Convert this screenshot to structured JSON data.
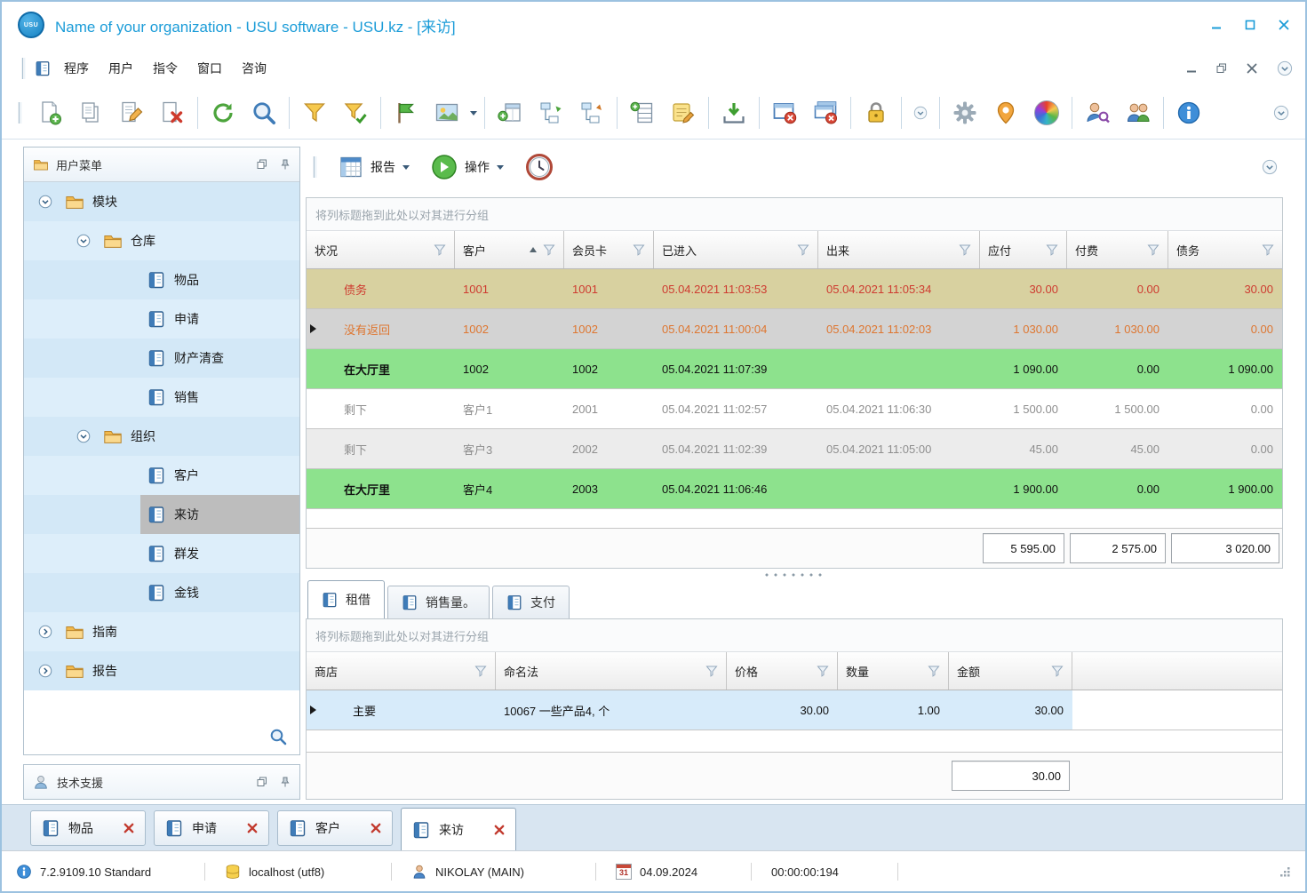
{
  "colors": {
    "accent_blue": "#1B9CD8",
    "row_debt_bg": "#D8D1A0",
    "row_debt_text": "#CE3B30",
    "row_no_return_bg": "#D3D3D3",
    "row_no_return_text": "#DE7630",
    "row_in_hall_bg": "#8DE28D",
    "row_left_text": "#8E8E8E",
    "selected_nav_bg": "#BDBDBD",
    "detail_row_bg": "#D7EBFA"
  },
  "window": {
    "title": "Name of your organization - USU software - USU.kz - [来访]",
    "logo": "USU"
  },
  "menubar": {
    "items": [
      {
        "label": "程序"
      },
      {
        "label": "用户"
      },
      {
        "label": "指令"
      },
      {
        "label": "窗口"
      },
      {
        "label": "咨询"
      }
    ]
  },
  "toolbar": {
    "icons": [
      "new-document",
      "copy",
      "edit",
      "delete",
      "refresh",
      "search",
      "filter",
      "filter-apply",
      "flag",
      "image",
      "add-column",
      "expand-tree",
      "collapse-tree",
      "add-row",
      "notes",
      "export",
      "close-window",
      "close-all-windows",
      "lock",
      "toolbar-overflow",
      "settings",
      "location",
      "colors",
      "user-search",
      "users",
      "info"
    ]
  },
  "sidebar": {
    "title": "用户菜单",
    "tree": [
      {
        "label": "模块",
        "type": "folder",
        "level": 0,
        "expanded": true
      },
      {
        "label": "仓库",
        "type": "folder",
        "level": 1,
        "expanded": true
      },
      {
        "label": "物品",
        "type": "item",
        "level": 2
      },
      {
        "label": "申请",
        "type": "item",
        "level": 2
      },
      {
        "label": "财产清查",
        "type": "item",
        "level": 2
      },
      {
        "label": "销售",
        "type": "item",
        "level": 2
      },
      {
        "label": "组织",
        "type": "folder",
        "level": 1,
        "expanded": true
      },
      {
        "label": "客户",
        "type": "item",
        "level": 2
      },
      {
        "label": "来访",
        "type": "item",
        "level": 2,
        "selected": true
      },
      {
        "label": "群发",
        "type": "item",
        "level": 2
      },
      {
        "label": "金钱",
        "type": "item",
        "level": 2
      },
      {
        "label": "指南",
        "type": "folder",
        "level": 0,
        "expanded": false
      },
      {
        "label": "报告",
        "type": "folder",
        "level": 0,
        "expanded": false
      }
    ],
    "support_panel": "技术支援"
  },
  "report_toolbar": {
    "report_button": "报告",
    "action_button": "操作"
  },
  "visits": {
    "group_hint": "将列标题拖到此处以对其进行分组",
    "columns": [
      "状况",
      "客户",
      "会员卡",
      "已进入",
      "出来",
      "应付",
      "付费",
      "债务"
    ],
    "rows": [
      {
        "status": "债务",
        "client": "1001",
        "card": "1001",
        "entered": "05.04.2021 11:03:53",
        "exited": "05.04.2021 11:05:34",
        "payable": "30.00",
        "paid": "0.00",
        "debt": "30.00",
        "state": "debt"
      },
      {
        "status": "没有返回",
        "client": "1002",
        "card": "1002",
        "entered": "05.04.2021 11:00:04",
        "exited": "05.04.2021 11:02:03",
        "payable": "1 030.00",
        "paid": "1 030.00",
        "debt": "0.00",
        "state": "no-return",
        "selected": true
      },
      {
        "status": "在大厅里",
        "client": "1002",
        "card": "1002",
        "entered": "05.04.2021 11:07:39",
        "exited": "",
        "payable": "1 090.00",
        "paid": "0.00",
        "debt": "1 090.00",
        "state": "in-hall"
      },
      {
        "status": "剩下",
        "client": "客户1",
        "card": "2001",
        "entered": "05.04.2021 11:02:57",
        "exited": "05.04.2021 11:06:30",
        "payable": "1 500.00",
        "paid": "1 500.00",
        "debt": "0.00",
        "state": "left"
      },
      {
        "status": "剩下",
        "client": "客户3",
        "card": "2002",
        "entered": "05.04.2021 11:02:39",
        "exited": "05.04.2021 11:05:00",
        "payable": "45.00",
        "paid": "45.00",
        "debt": "0.00",
        "state": "left"
      },
      {
        "status": "在大厅里",
        "client": "客户4",
        "card": "2003",
        "entered": "05.04.2021 11:06:46",
        "exited": "",
        "payable": "1 900.00",
        "paid": "0.00",
        "debt": "1 900.00",
        "state": "in-hall"
      }
    ],
    "totals": {
      "payable": "5 595.00",
      "paid": "2 575.00",
      "debt": "3 020.00"
    }
  },
  "detail": {
    "tabs": [
      {
        "label": "租借",
        "active": true
      },
      {
        "label": "销售量。",
        "active": false
      },
      {
        "label": "支付",
        "active": false
      }
    ],
    "group_hint": "将列标题拖到此处以对其进行分组",
    "columns": [
      "商店",
      "命名法",
      "价格",
      "数量",
      "金额"
    ],
    "rows": [
      {
        "store": "主要",
        "nomenclature": "10067 一些产品4, 个",
        "price": "30.00",
        "qty": "1.00",
        "amount": "30.00"
      }
    ],
    "total": "30.00"
  },
  "bottom_tabs": [
    {
      "label": "物品",
      "active": false
    },
    {
      "label": "申请",
      "active": false
    },
    {
      "label": "客户",
      "active": false
    },
    {
      "label": "来访",
      "active": true
    }
  ],
  "statusbar": {
    "version": "7.2.9109.10 Standard",
    "database": "localhost (utf8)",
    "user": "NIKOLAY (MAIN)",
    "date": "04.09.2024",
    "timer": "00:00:00:194",
    "calendar_day": "31"
  }
}
